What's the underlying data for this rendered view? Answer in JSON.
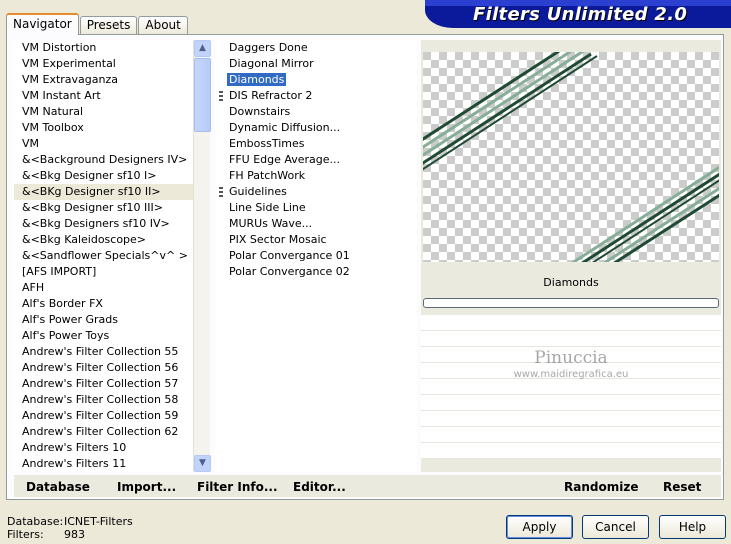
{
  "tabs": [
    "Navigator",
    "Presets",
    "About"
  ],
  "title": "Filters Unlimited 2.0",
  "categories": [
    "VM Distortion",
    "VM Experimental",
    "VM Extravaganza",
    "VM Instant Art",
    "VM Natural",
    "VM Toolbox",
    "VM",
    "&<Background Designers IV>",
    "&<Bkg Designer sf10 I>",
    "&<BKg Designer sf10 II>",
    "&<Bkg Designer sf10 III>",
    "&<Bkg Designers sf10 IV>",
    "&<Bkg Kaleidoscope>",
    "&<Sandflower Specials^v^ >",
    "[AFS IMPORT]",
    "AFH",
    "Alf's Border FX",
    "Alf's Power Grads",
    "Alf's Power Toys",
    "Andrew's Filter Collection 55",
    "Andrew's Filter Collection 56",
    "Andrew's Filter Collection 57",
    "Andrew's Filter Collection 58",
    "Andrew's Filter Collection 59",
    "Andrew's Filter Collection 62",
    "Andrew's Filters 10",
    "Andrew's Filters 11"
  ],
  "selected_category_index": 9,
  "filters": [
    "Daggers Done",
    "Diagonal Mirror",
    "Diamonds",
    "DIS Refractor 2",
    "Downstairs",
    "Dynamic Diffusion...",
    "EmbossTimes",
    "FFU Edge Average...",
    "FH PatchWork",
    "Guidelines",
    "Line Side Line",
    "MURUs Wave...",
    "PIX Sector Mosaic",
    "Polar Convergance 01",
    "Polar Convergance 02"
  ],
  "selected_filter_index": 2,
  "marked_filters": [
    3,
    9
  ],
  "filter_name": "Diamonds",
  "watermark": {
    "name": "Pinuccia",
    "url": "www.maidiregrafica.eu"
  },
  "bottom_buttons": {
    "database": "Database",
    "import": "Import...",
    "filter_info": "Filter Info...",
    "editor": "Editor...",
    "randomize": "Randomize",
    "reset": "Reset"
  },
  "status": {
    "database_label": "Database:",
    "database_value": "ICNET-Filters",
    "filters_label": "Filters:",
    "filters_value": "983"
  },
  "dialog_buttons": {
    "apply": "Apply",
    "cancel": "Cancel",
    "help": "Help"
  },
  "colors": {
    "banner": "#0a1a9a",
    "selection": "#316ac5",
    "stripe_dark": "#1f4a33",
    "stripe_light": "#86ae98"
  }
}
